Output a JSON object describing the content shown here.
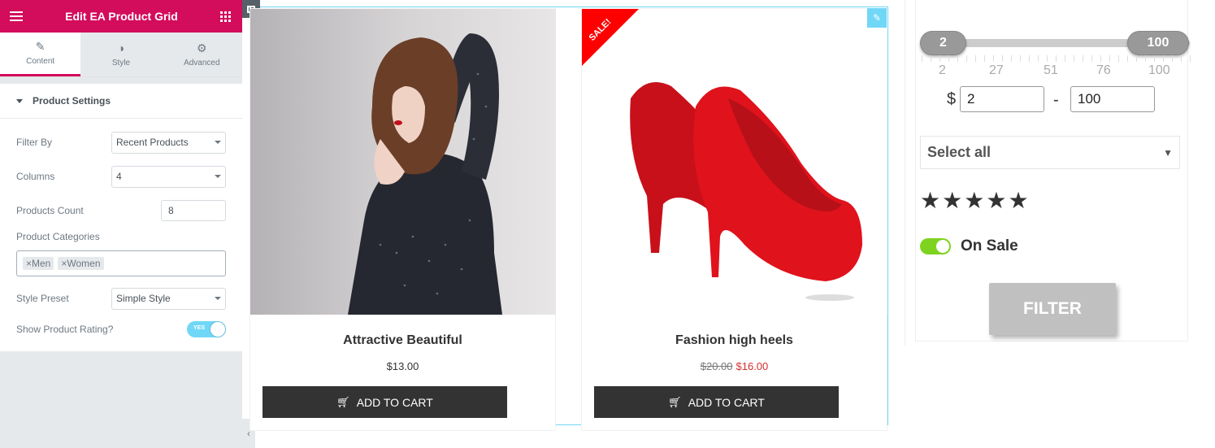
{
  "editor": {
    "title": "Edit EA Product Grid",
    "tabs": [
      {
        "label": "Content",
        "icon": "pencil-icon"
      },
      {
        "label": "Style",
        "icon": "contrast-icon"
      },
      {
        "label": "Advanced",
        "icon": "gear-icon"
      }
    ],
    "section_title": "Product Settings",
    "filter_by": {
      "label": "Filter By",
      "value": "Recent Products"
    },
    "columns": {
      "label": "Columns",
      "value": "4"
    },
    "products_count": {
      "label": "Products Count",
      "value": "8"
    },
    "categories": {
      "label": "Product Categories",
      "tags": [
        "Men",
        "Women"
      ]
    },
    "style_preset": {
      "label": "Style Preset",
      "value": "Simple Style"
    },
    "show_rating": {
      "label": "Show Product Rating?",
      "toggle_text": "YES",
      "on": true
    },
    "accent_color": "#d30c5c"
  },
  "products": [
    {
      "name": "Attractive Beautiful",
      "price": "$13.00",
      "button": "ADD TO CART",
      "on_sale": false
    },
    {
      "name": "Fashion high heels",
      "old_price": "$20.00",
      "price": "$16.00",
      "button": "ADD TO CART",
      "on_sale": true,
      "badge": "SALE!"
    }
  ],
  "filter": {
    "range_min": "2",
    "range_max": "100",
    "ticks": [
      "2",
      "27",
      "51",
      "76",
      "100"
    ],
    "currency": "$",
    "min_value": "2",
    "max_value": "100",
    "separator": "-",
    "category_select": "Select all",
    "rating_stars": 5,
    "on_sale_label": "On Sale",
    "on_sale": true,
    "button_label": "FILTER"
  }
}
